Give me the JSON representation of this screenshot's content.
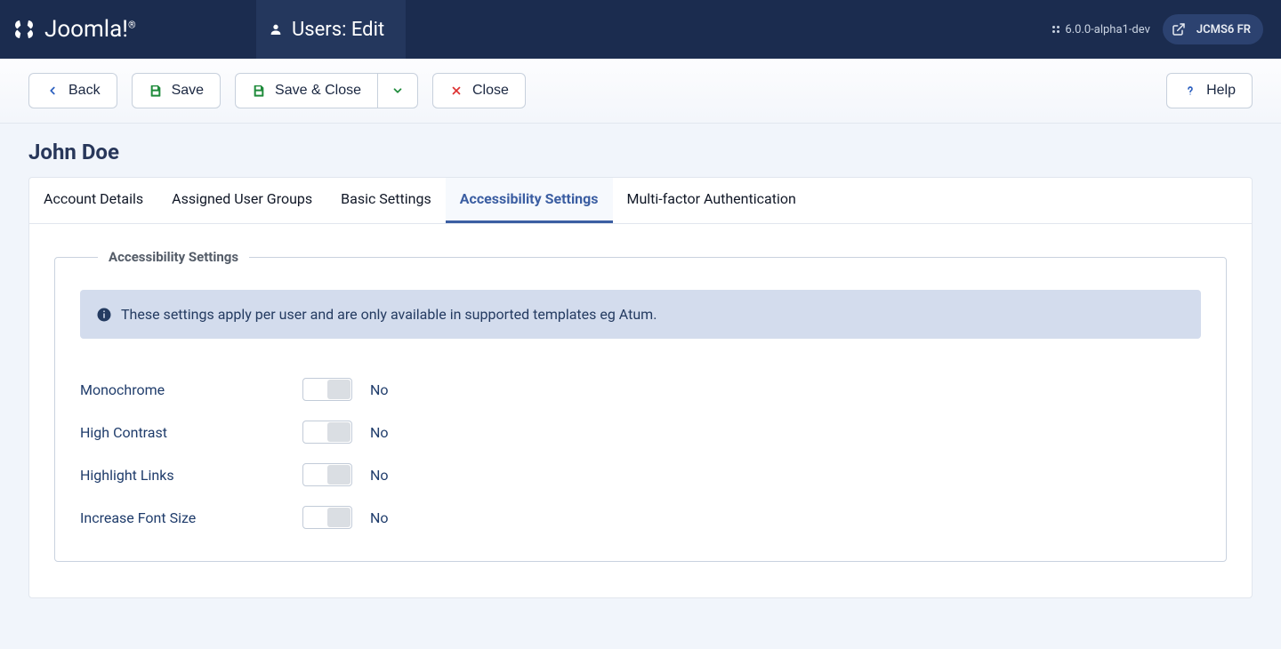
{
  "brand": {
    "name": "Joomla!",
    "registered": "®"
  },
  "header": {
    "title": "Users: Edit",
    "version": "6.0.0-alpha1-dev",
    "site_label": "JCMS6 FR"
  },
  "toolbar": {
    "back": "Back",
    "save": "Save",
    "save_close": "Save & Close",
    "close": "Close",
    "help": "Help"
  },
  "page": {
    "title": "John Doe"
  },
  "tabs": [
    {
      "label": "Account Details",
      "active": false
    },
    {
      "label": "Assigned User Groups",
      "active": false
    },
    {
      "label": "Basic Settings",
      "active": false
    },
    {
      "label": "Accessibility Settings",
      "active": true
    },
    {
      "label": "Multi-factor Authentication",
      "active": false
    }
  ],
  "a11y": {
    "legend": "Accessibility Settings",
    "info": "These settings apply per user and are only available in supported templates eg Atum.",
    "fields": [
      {
        "label": "Monochrome",
        "state": "No"
      },
      {
        "label": "High Contrast",
        "state": "No"
      },
      {
        "label": "Highlight Links",
        "state": "No"
      },
      {
        "label": "Increase Font Size",
        "state": "No"
      }
    ]
  }
}
